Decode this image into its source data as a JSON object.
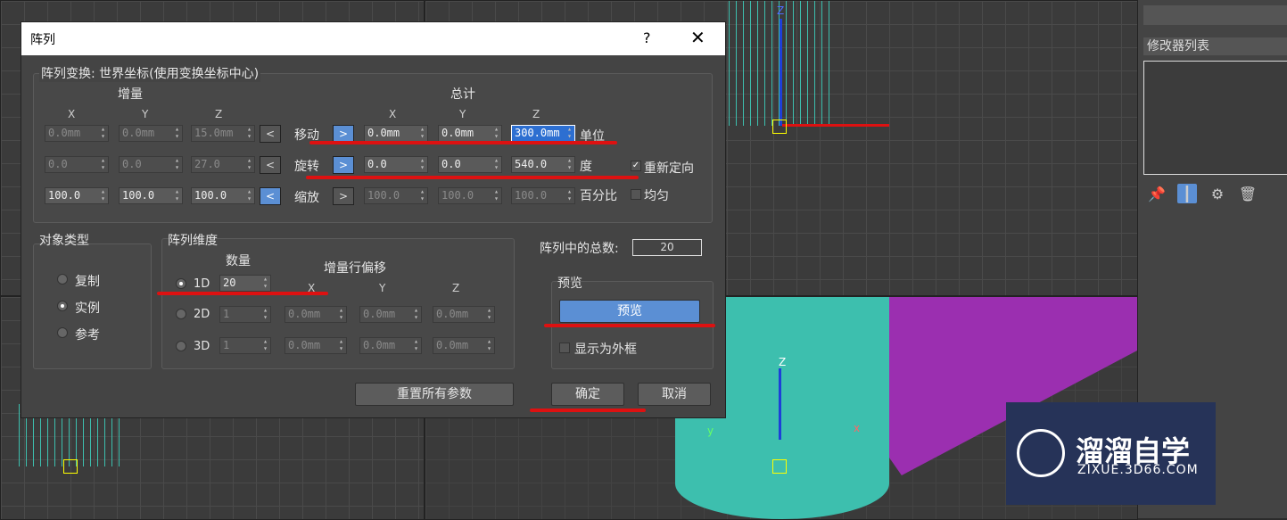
{
  "dialog": {
    "title": "阵列",
    "help": "?",
    "close": "✕",
    "transform_group": "阵列变换: 世界坐标(使用变换坐标中心)",
    "increment": "增量",
    "totals": "总计",
    "axis_x": "X",
    "axis_y": "Y",
    "axis_z": "Z",
    "rows": [
      {
        "label": "移动",
        "inc": [
          "0.0mm",
          "0.0mm",
          "15.0mm"
        ],
        "tot": [
          "0.0mm",
          "0.0mm",
          "300.0mm"
        ],
        "unit": "单位"
      },
      {
        "label": "旋转",
        "inc": [
          "0.0",
          "0.0",
          "27.0"
        ],
        "tot": [
          "0.0",
          "0.0",
          "540.0"
        ],
        "unit": "度"
      },
      {
        "label": "缩放",
        "inc": [
          "100.0",
          "100.0",
          "100.0"
        ],
        "tot": [
          "100.0",
          "100.0",
          "100.0"
        ],
        "unit": "百分比"
      }
    ],
    "reorient": "重新定向",
    "uniform": "均匀",
    "object_type": {
      "title": "对象类型",
      "options": [
        "复制",
        "实例",
        "参考"
      ],
      "selected": 1
    },
    "array_dims": {
      "title": "阵列维度",
      "count_header": "数量",
      "offset_header": "增量行偏移",
      "dims": [
        {
          "label": "1D",
          "count": "20",
          "x": "",
          "y": "",
          "z": ""
        },
        {
          "label": "2D",
          "count": "1",
          "x": "0.0mm",
          "y": "0.0mm",
          "z": "0.0mm"
        },
        {
          "label": "3D",
          "count": "1",
          "x": "0.0mm",
          "y": "0.0mm",
          "z": "0.0mm"
        }
      ]
    },
    "total_label": "阵列中的总数:",
    "total_value": "20",
    "preview": {
      "title": "预览",
      "button": "预览",
      "show_box": "显示为外框"
    },
    "reset_button": "重置所有参数",
    "ok_button": "确定",
    "cancel_button": "取消"
  },
  "right_panel": {
    "modifier_list": "修改器列表"
  },
  "watermark": {
    "brand": "溜溜自学",
    "url": "ZIXUE.3D66.COM"
  },
  "viewport_labels": {
    "z1": "Z",
    "z2": "Z",
    "x2": "x",
    "y2": "y"
  },
  "colors": {
    "highlight": "#5b8fd4",
    "annotation": "#d11111",
    "object": "#3dbfae",
    "plane": "#9b2fb0"
  }
}
